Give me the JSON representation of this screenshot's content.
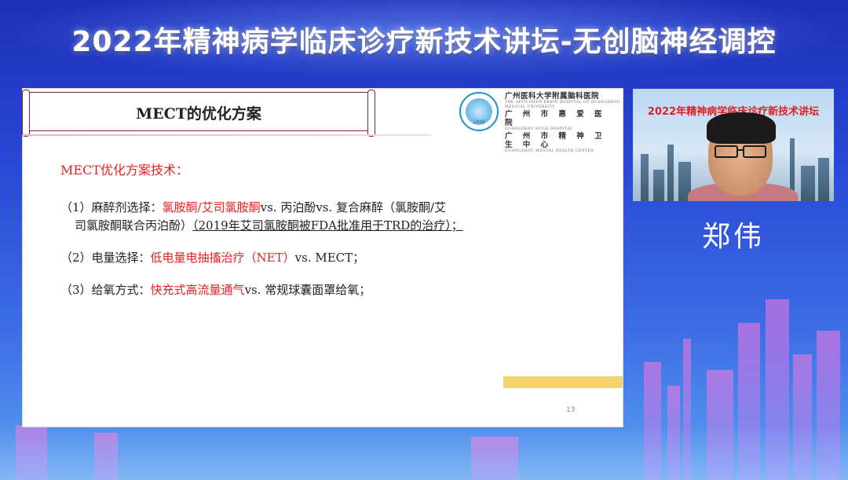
{
  "banner": {
    "title": "2022年精神病学临床诊疗新技术讲坛-无创脑神经调控"
  },
  "slide": {
    "title": "MECT的优化方案",
    "logo": {
      "line1": "广州医科大学附属脑科医院",
      "line1_sub": "THE AFFILIATED BRAIN HOSPITAL OF GUANGZHOU MEDICAL UNIVERSITY",
      "line2": "广 州 市 惠 爱 医 院",
      "line2_sub": "GUANGZHOU HUIAI HOSPITAL",
      "line3": "广 州 市 精 神 卫 生 中 心",
      "line3_sub": "GUANGZHOU MENTAL HEALTH CENTER",
      "year": "1898"
    },
    "heading": "MECT优化方案技术：",
    "item1": {
      "prefix": "（1）麻醉剂选择：",
      "red": "氯胺酮/艾司氯胺酮",
      "rest_line1": "vs. 丙泊酚vs. 复合麻醉（氯胺酮/艾",
      "line2_plain": "司氯胺酮联合丙泊酚）",
      "line2_underlined": "（2019年艾司氯胺酮被FDA批准用于TRD的治疗）；"
    },
    "item2": {
      "prefix": "（2）电量选择：",
      "red": "低电量电抽搐治疗（NET）",
      "rest": "vs. MECT；"
    },
    "item3": {
      "prefix": "（3）给氧方式：",
      "red": "快充式高流量通气",
      "rest": "vs. 常规球囊面罩给氧；"
    },
    "page_number": "13"
  },
  "webcam": {
    "banner_text": "2022年精神病学临床诊疗新技术讲坛",
    "sub_text": "2022"
  },
  "speaker": {
    "name": "郑伟"
  },
  "colors": {
    "accent_red": "#e52222",
    "banner_blue": "#2a49d6",
    "slide_yellow": "#f5d36c"
  }
}
